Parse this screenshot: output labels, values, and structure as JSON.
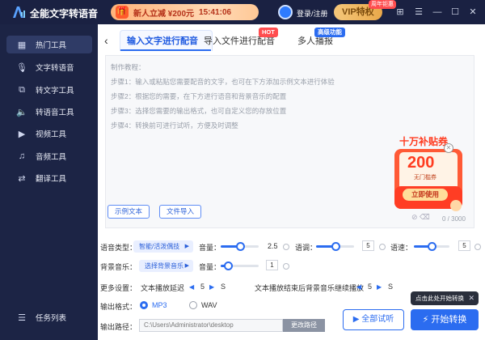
{
  "app": {
    "title": "全能文字转语音",
    "promo_text": "新人立减 ¥200元",
    "promo_time": "15:41:06",
    "login_label": "登录/注册",
    "vip_label": "VIP特权",
    "vip_tag": "周年钜惠",
    "window_buttons": {
      "skin": "⊞",
      "menu": "☰",
      "minimize": "—",
      "maximize": "☐",
      "close": "✕"
    }
  },
  "sidebar": {
    "items": [
      {
        "label": "热门工具",
        "icon": "hot-icon"
      },
      {
        "label": "文字转语音",
        "icon": "mic-icon"
      },
      {
        "label": "转文字工具",
        "icon": "text-icon"
      },
      {
        "label": "转语音工具",
        "icon": "speaker-icon"
      },
      {
        "label": "视频工具",
        "icon": "video-icon"
      },
      {
        "label": "音频工具",
        "icon": "audio-icon"
      },
      {
        "label": "翻译工具",
        "icon": "translate-icon"
      }
    ],
    "task_list": "任务列表"
  },
  "tabs": [
    {
      "label": "输入文字进行配音"
    },
    {
      "label": "导入文件进行配音",
      "badge": "HOT"
    },
    {
      "label": "多人播报",
      "badge": "高级功能"
    }
  ],
  "editor": {
    "lines": [
      "制作教程：",
      "步骤1：输入或粘贴您需要配音的文字，也可在下方添加示例文本进行体验",
      "步骤2：根据您的需要，在下方进行语音和背景音乐的配置",
      "步骤3：选择您需要的输出格式，也可自定义您的存放位置",
      "步骤4：转换前可进行试听，方便及时调整"
    ],
    "example_btn": "示例文本",
    "import_btn": "文件导入",
    "char_count": "0 / 3000"
  },
  "coupon": {
    "title": "十万补贴券",
    "amount": "200",
    "sub": "无门槛券",
    "cta": "立即使用",
    "close": "✕"
  },
  "settings": {
    "voice_type_label": "语音类型：",
    "voice_type_value": "智能/活泼偶技",
    "volume_label": "音量：",
    "volume_value": "2.5",
    "volume_fraction": 0.5,
    "tone_label": "语调：",
    "tone_value": "5",
    "tone_fraction": 0.5,
    "speed_label": "语速：",
    "speed_value": "5",
    "speed_fraction": 0.5,
    "bgm_label": "背景音乐：",
    "bgm_value": "选择背景音乐",
    "bgm_volume_label": "音量：",
    "bgm_volume_value": "1",
    "bgm_volume_fraction": 0.2,
    "more_label": "更多设置：",
    "delay_label": "文本播放延迟",
    "delay_value": "5",
    "delay_unit": "S",
    "after_label": "文本播放结束后背景音乐继续播放",
    "after_value": "5",
    "after_unit": "S",
    "format_label": "输出格式：",
    "format_mp3": "MP3",
    "format_wav": "WAV",
    "format_selected": "MP3",
    "path_label": "输出路径：",
    "path_value": "C:\\Users\\Administrator\\desktop",
    "change_path_btn": "更改路径",
    "trial_btn": "全部试听",
    "convert_btn": "开始转换",
    "tooltip": "点击此处开始转换"
  },
  "colors": {
    "sidebar_bg": "#1c2445",
    "accent": "#2b6cf0",
    "hot_badge": "#ff4d4f",
    "adv_badge": "#2b6cf0",
    "coupon_red": "#ff4a2a"
  }
}
